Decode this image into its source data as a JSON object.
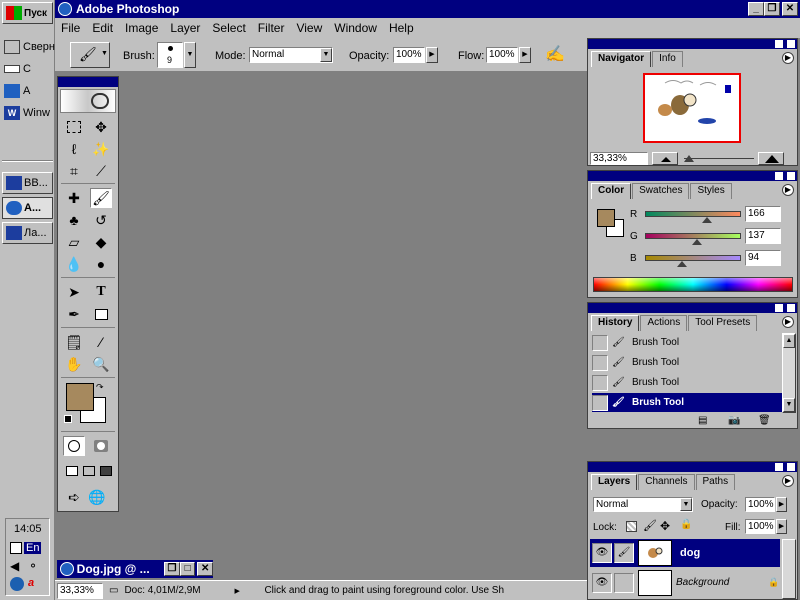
{
  "taskbar": {
    "items": [
      {
        "label": "Пуск"
      },
      {
        "label": "Сверн"
      },
      {
        "label": "С"
      },
      {
        "label": "А"
      },
      {
        "label": "Winw"
      }
    ],
    "tasks": [
      {
        "label": "ВВ..."
      },
      {
        "label": "А..."
      },
      {
        "label": "Ла..."
      }
    ],
    "clock": "14:05",
    "lang": "En"
  },
  "app": {
    "title": "Adobe Photoshop",
    "menu": [
      "File",
      "Edit",
      "Image",
      "Layer",
      "Select",
      "Filter",
      "View",
      "Window",
      "Help"
    ]
  },
  "options": {
    "brush_label": "Brush:",
    "brush_size": "9",
    "mode_label": "Mode:",
    "mode_value": "Normal",
    "opacity_label": "Opacity:",
    "opacity_value": "100%",
    "flow_label": "Flow:",
    "flow_value": "100%"
  },
  "navigator": {
    "tabs": [
      "Navigator",
      "Info"
    ],
    "zoom": "33,33%"
  },
  "color": {
    "tabs": [
      "Color",
      "Swatches",
      "Styles"
    ],
    "r_label": "R",
    "g_label": "G",
    "b_label": "B",
    "r": "166",
    "g": "137",
    "b": "94",
    "fg": "#a6895e"
  },
  "history": {
    "tabs": [
      "History",
      "Actions",
      "Tool Presets"
    ],
    "items": [
      "Brush Tool",
      "Brush Tool",
      "Brush Tool",
      "Brush Tool"
    ]
  },
  "layers": {
    "tabs": [
      "Layers",
      "Channels",
      "Paths"
    ],
    "blend": "Normal",
    "opacity_label": "Opacity:",
    "opacity": "100%",
    "lock_label": "Lock:",
    "fill_label": "Fill:",
    "fill": "100%",
    "items": [
      "dog",
      "Background"
    ]
  },
  "document": {
    "title": "Dog.jpg @ ..."
  },
  "status": {
    "zoom": "33,33%",
    "doc": "Doc: 4,01M/2,9M",
    "hint": "Click and drag to paint using foreground color.  Use Sh"
  }
}
